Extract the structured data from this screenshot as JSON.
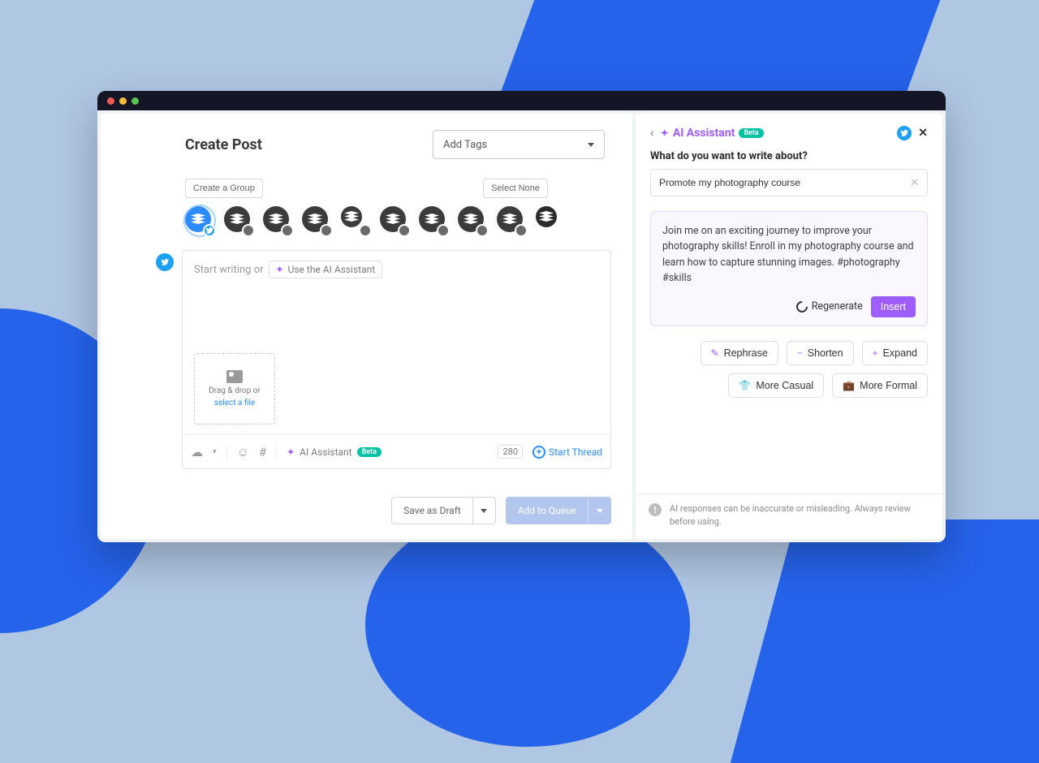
{
  "header": {
    "title": "Create Post",
    "add_tags_label": "Add Tags"
  },
  "channels_bar": {
    "create_group": "Create a Group",
    "select_none": "Select None"
  },
  "channels": [
    {
      "network": "twitter",
      "selected": true
    },
    {
      "network": "instagram",
      "selected": false
    },
    {
      "network": "facebook",
      "selected": false
    },
    {
      "network": "linkedin",
      "selected": false
    },
    {
      "network": "youtube",
      "selected": false
    },
    {
      "network": "tiktok",
      "selected": false
    },
    {
      "network": "pinterest",
      "selected": false
    },
    {
      "network": "mastodon",
      "selected": false
    },
    {
      "network": "googlebusiness",
      "selected": false
    },
    {
      "network": "startpage",
      "selected": false
    }
  ],
  "composer": {
    "placeholder_prefix": "Start writing or",
    "ai_chip": "Use the AI Assistant",
    "dropzone_line1": "Drag & drop or",
    "dropzone_link": "select a file",
    "ai_toolbar": "AI Assistant",
    "beta": "Beta",
    "char_count": "280",
    "start_thread": "Start Thread"
  },
  "footer": {
    "save_draft": "Save as Draft",
    "add_queue": "Add to Queue"
  },
  "assistant": {
    "title": "AI Assistant",
    "beta": "Beta",
    "prompt_label": "What do you want to write about?",
    "prompt_value": "Promote my photography course",
    "result": "Join me on an exciting journey to improve your photography skills! Enroll in my photography course and learn how to capture stunning images. #photography #skills",
    "regenerate": "Regenerate",
    "insert": "Insert",
    "tools": {
      "rephrase": "Rephrase",
      "shorten": "Shorten",
      "expand": "Expand",
      "casual": "More Casual",
      "formal": "More Formal"
    },
    "warning": "AI responses can be inaccurate or misleading. Always review before using."
  }
}
